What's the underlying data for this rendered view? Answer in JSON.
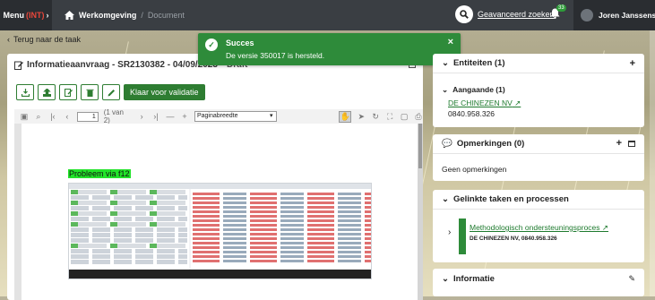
{
  "topbar": {
    "menu_label": "Menu",
    "env_label": "(INT)",
    "home_label": "Werkomgeving",
    "separator": "/",
    "doc_label": "Document",
    "advanced_search": "Geavanceerd zoeken",
    "notification_count": "33",
    "user_name": "Joren Janssens"
  },
  "back_link": "Terug naar de taak",
  "document": {
    "title": "Informatieaanvraag - SR2130382 - 04/09/2023 -",
    "status": "Draft",
    "validate_button": "Klaar voor validatie"
  },
  "viewer": {
    "page_value": "1",
    "page_count": "(1 van 2)",
    "zoom_option": "Paginabreedte",
    "highlight_text": "Probleem via f12"
  },
  "toast": {
    "title": "Succes",
    "message": "De versie 350017 is hersteld."
  },
  "entities": {
    "title": "Entiteiten (1)",
    "group": "Aangaande (1)",
    "company": "DE CHINEZEN NV",
    "number": "0840.958.326"
  },
  "comments": {
    "title": "Opmerkingen (0)",
    "empty": "Geen opmerkingen"
  },
  "linked": {
    "title": "Gelinkte taken en processen",
    "item_title": "Methodologisch ondersteuningsproces",
    "item_sub": "DE CHINEZEN NV, 0840.958.326"
  },
  "info": {
    "title": "Informatie"
  },
  "colors": {
    "accent_green": "#2e7d32",
    "toast_green": "#2e8b3a",
    "topbar": "#3a3e43",
    "env_red": "#e8463a"
  }
}
